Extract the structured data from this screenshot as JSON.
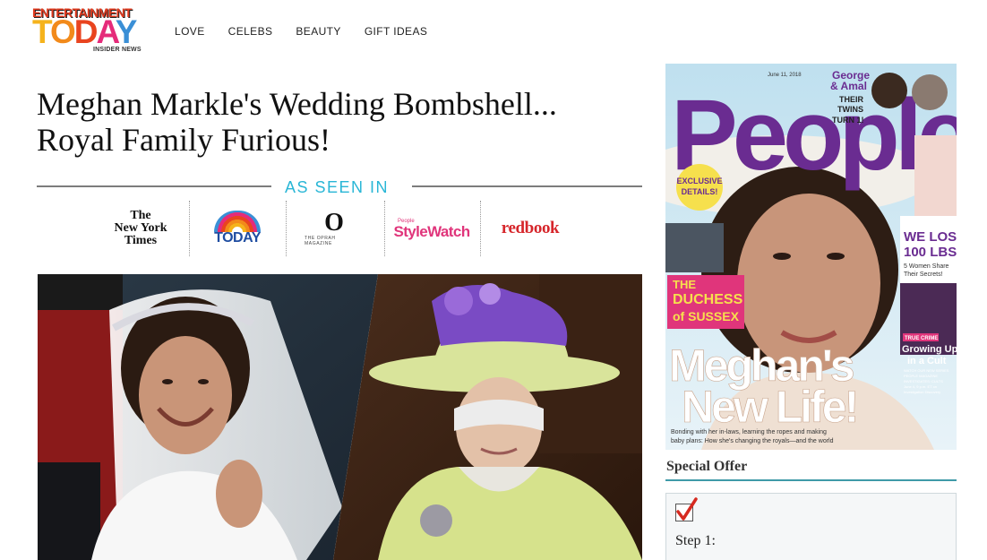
{
  "logo": {
    "top": "ENTERTAINMENT",
    "main": [
      "T",
      "O",
      "D",
      "A",
      "Y"
    ],
    "sub": "INSIDER NEWS"
  },
  "nav": {
    "items": [
      "LOVE",
      "CELEBS",
      "BEAUTY",
      "GIFT IDEAS"
    ]
  },
  "article": {
    "headline_line1": "Meghan Markle's Wedding Bombshell...",
    "headline_line2": "Royal Family Furious!"
  },
  "as_seen_in": {
    "label": "AS SEEN IN",
    "logos": {
      "nyt": [
        "The",
        "New York",
        "Times"
      ],
      "today": "TODAY",
      "oprah_letter": "O",
      "oprah_sub": "THE OPRAH MAGAZINE",
      "stylewatch_small": "People",
      "stylewatch": "StyleWatch",
      "redbook": "redbook"
    }
  },
  "cover": {
    "masthead": "People",
    "date": "June 11, 2018",
    "george": [
      "George",
      "& Amal"
    ],
    "twins": [
      "THEIR",
      "TWINS",
      "TURN 1!"
    ],
    "exclusive": [
      "EXCLUSIVE",
      "DETAILS!"
    ],
    "duchess": [
      "THE",
      "DUCHESS",
      "of SUSSEX"
    ],
    "main_line1": "Meghan's",
    "main_line2": "New Life!",
    "tagline_1": "Bonding with her in-laws, learning the ropes and making",
    "tagline_2": "baby plans: How she's changing the royals—and the world",
    "lost": [
      "WE LOST",
      "100 LBS."
    ],
    "lost_sub": [
      "5 Women Share",
      "Their Secrets!"
    ],
    "truecrime": "TRUE CRIME",
    "cult": [
      "Growing Up",
      "in a Cult"
    ],
    "cult_sub": [
      "WATCH OUR NEW SERIES",
      "PEOPLE MAGAZINE",
      "INVESTIGATES: CULTS",
      "June 4, 9 p.m. ET on",
      "Investigation Discovery"
    ]
  },
  "special_offer": {
    "title": "Special Offer",
    "step_label": "Step 1:"
  },
  "colors": {
    "accent_teal": "#29b6d6",
    "offer_rule": "#3f9aa8",
    "people_purple": "#6a2c91",
    "cover_pink": "#e0357b"
  }
}
